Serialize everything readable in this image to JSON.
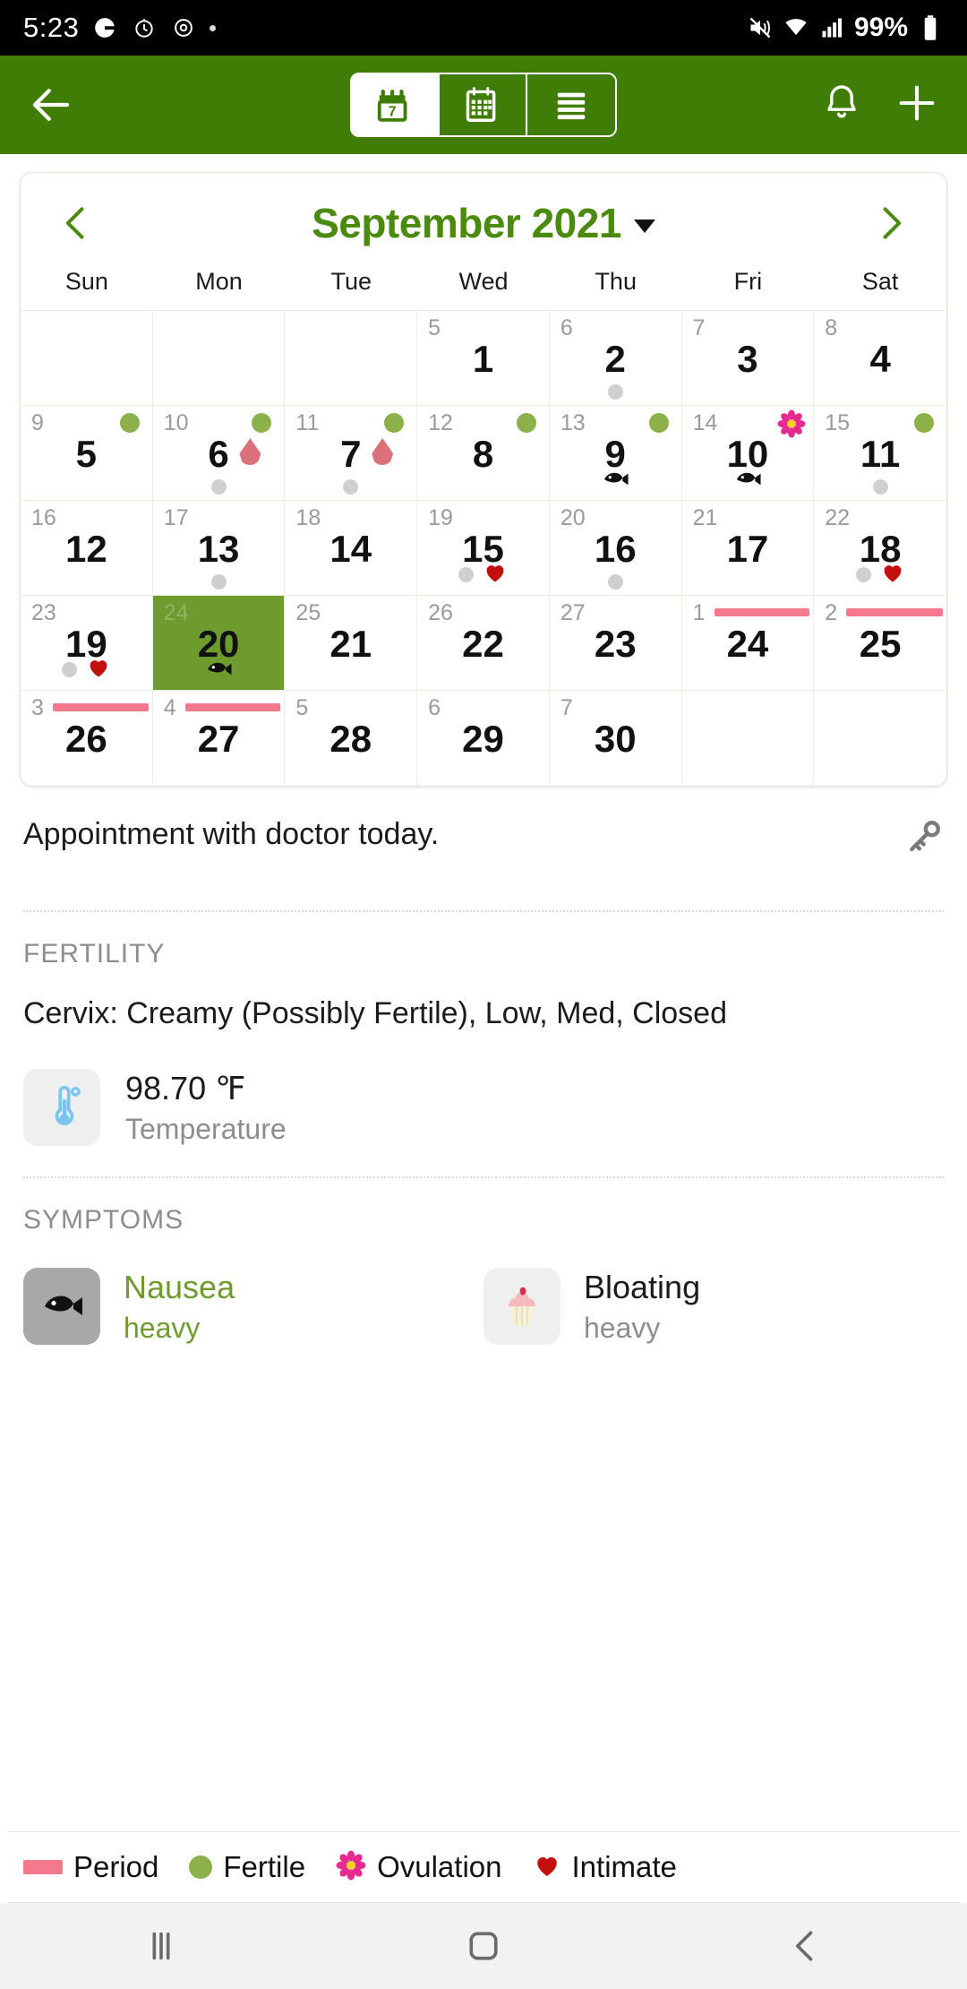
{
  "status_bar": {
    "time": "5:23",
    "icons": [
      "google-icon",
      "alarm-icon",
      "timer-icon",
      "small-dot-icon"
    ],
    "right_icons": [
      "mute-icon",
      "wifi-icon",
      "signal-icon"
    ],
    "battery_percent": "99%"
  },
  "app_bar": {
    "back_label": "back-arrow",
    "tabs": [
      {
        "id": "day-view",
        "icon": "calendar-day-icon",
        "active": true
      },
      {
        "id": "month-view",
        "icon": "calendar-month-icon",
        "active": false
      },
      {
        "id": "list-view",
        "icon": "list-icon",
        "active": false
      }
    ],
    "notification_icon": "bell-icon",
    "add_icon": "plus-icon",
    "accent_color": "#3f7d06"
  },
  "calendar": {
    "prev_label": "‹",
    "next_label": "›",
    "title": "September 2021",
    "dropdown_icon": "caret-down-icon",
    "day_headers": [
      "Sun",
      "Mon",
      "Tue",
      "Wed",
      "Thu",
      "Fri",
      "Sat"
    ],
    "selected_day": "20",
    "weeks": [
      [
        {
          "day": "",
          "cycle": ""
        },
        {
          "day": "",
          "cycle": ""
        },
        {
          "day": "",
          "cycle": ""
        },
        {
          "day": "1",
          "cycle": "5"
        },
        {
          "day": "2",
          "cycle": "6",
          "note": true
        },
        {
          "day": "3",
          "cycle": "7"
        },
        {
          "day": "4",
          "cycle": "8"
        }
      ],
      [
        {
          "day": "5",
          "cycle": "9",
          "fertile": true
        },
        {
          "day": "6",
          "cycle": "10",
          "fertile": true,
          "drop": true,
          "note": true
        },
        {
          "day": "7",
          "cycle": "11",
          "fertile": true,
          "drop": true,
          "note": true
        },
        {
          "day": "8",
          "cycle": "12",
          "fertile": true
        },
        {
          "day": "9",
          "cycle": "13",
          "fertile": true,
          "fish": true
        },
        {
          "day": "10",
          "cycle": "14",
          "ovulation": true,
          "fish": true
        },
        {
          "day": "11",
          "cycle": "15",
          "fertile": true,
          "note": true
        }
      ],
      [
        {
          "day": "12",
          "cycle": "16"
        },
        {
          "day": "13",
          "cycle": "17",
          "note": true
        },
        {
          "day": "14",
          "cycle": "18"
        },
        {
          "day": "15",
          "cycle": "19",
          "note": true,
          "intimate": true
        },
        {
          "day": "16",
          "cycle": "20",
          "note": true
        },
        {
          "day": "17",
          "cycle": "21"
        },
        {
          "day": "18",
          "cycle": "22",
          "note": true,
          "intimate": true
        }
      ],
      [
        {
          "day": "19",
          "cycle": "23",
          "note": true,
          "intimate": true
        },
        {
          "day": "20",
          "cycle": "24",
          "selected": true,
          "fish": true
        },
        {
          "day": "21",
          "cycle": "25"
        },
        {
          "day": "22",
          "cycle": "26"
        },
        {
          "day": "23",
          "cycle": "27"
        },
        {
          "day": "24",
          "cycle": "1",
          "period": true
        },
        {
          "day": "25",
          "cycle": "2",
          "period": true
        }
      ],
      [
        {
          "day": "26",
          "cycle": "3",
          "period": true
        },
        {
          "day": "27",
          "cycle": "4",
          "period": true
        },
        {
          "day": "28",
          "cycle": "5"
        },
        {
          "day": "29",
          "cycle": "6"
        },
        {
          "day": "30",
          "cycle": "7"
        },
        {
          "day": "",
          "cycle": ""
        },
        {
          "day": "",
          "cycle": ""
        }
      ]
    ]
  },
  "notes": {
    "text": "Appointment with doctor today.",
    "key_icon": "key-icon"
  },
  "fertility": {
    "title": "FERTILITY",
    "cervix": "Cervix: Creamy (Possibly Fertile), Low, Med, Closed",
    "temperature_value": "98.70 ℉",
    "temperature_label": "Temperature",
    "temperature_icon": "thermometer-icon"
  },
  "symptoms": {
    "title": "SYMPTOMS",
    "items": [
      {
        "icon": "fish-icon",
        "name": "Nausea",
        "severity": "heavy",
        "highlight": true
      },
      {
        "icon": "cupcake-icon",
        "name": "Bloating",
        "severity": "heavy",
        "highlight": false
      }
    ]
  },
  "legend": {
    "items": [
      {
        "icon": "period-bar-icon",
        "label": "Period",
        "color": "#f4798e"
      },
      {
        "icon": "fertile-dot-icon",
        "label": "Fertile",
        "color": "#8cb14a"
      },
      {
        "icon": "ovulation-flower-icon",
        "label": "Ovulation",
        "color": "#e62a8f"
      },
      {
        "icon": "intimate-heart-icon",
        "label": "Intimate",
        "color": "#c40f0f"
      }
    ]
  },
  "nav_bar": {
    "recents_icon": "recents-icon",
    "home_icon": "home-icon",
    "back_icon": "back-icon"
  }
}
